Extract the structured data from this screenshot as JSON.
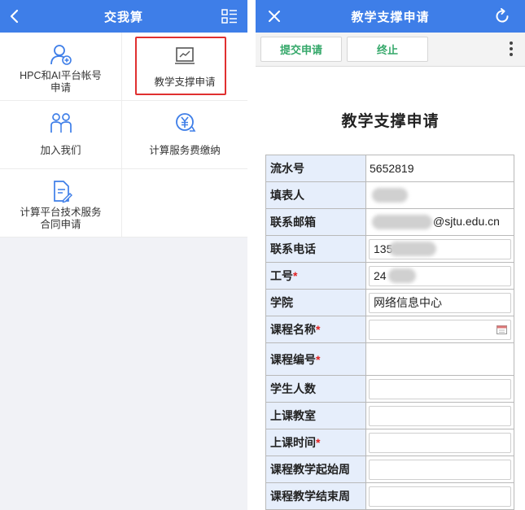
{
  "left": {
    "header": {
      "title": "交我算"
    },
    "tiles": [
      {
        "label": "HPC和AI平台帐号申请",
        "icon": "user-add-icon"
      },
      {
        "label": "教学支撑申请",
        "icon": "monitor-chart-icon"
      },
      {
        "label": "加入我们",
        "icon": "people-icon"
      },
      {
        "label": "计算服务费缴纳",
        "icon": "yuan-payment-icon"
      },
      {
        "label": "计算平台技术服务合同申请",
        "icon": "document-edit-icon"
      }
    ]
  },
  "right": {
    "header": {
      "title": "教学支撑申请"
    },
    "toolbar": {
      "submit_label": "提交申请",
      "stop_label": "终止"
    },
    "form": {
      "title": "教学支撑申请",
      "fields": [
        {
          "label": "流水号",
          "required": false,
          "value": "5652819"
        },
        {
          "label": "填表人",
          "required": false,
          "value": ""
        },
        {
          "label": "联系邮箱",
          "required": false,
          "value": "@sjtu.edu.cn"
        },
        {
          "label": "联系电话",
          "required": false,
          "value": "135"
        },
        {
          "label": "工号",
          "required": true,
          "value": "24"
        },
        {
          "label": "学院",
          "required": false,
          "value": "网络信息中心"
        },
        {
          "label": "课程名称",
          "required": true,
          "value": ""
        },
        {
          "label": "课程编号",
          "required": true,
          "value": ""
        },
        {
          "label": "学生人数",
          "required": false,
          "value": ""
        },
        {
          "label": "上课教室",
          "required": false,
          "value": ""
        },
        {
          "label": "上课时间",
          "required": true,
          "value": ""
        },
        {
          "label": "课程教学起始周",
          "required": false,
          "value": ""
        },
        {
          "label": "课程教学结束周",
          "required": false,
          "value": ""
        }
      ],
      "required_mark": "*"
    }
  },
  "colors": {
    "header_blue": "#3e7ee8",
    "button_green": "#35a86a",
    "label_bg": "#e6eefb",
    "required_red": "#e02020",
    "highlight_red": "#e03030"
  }
}
